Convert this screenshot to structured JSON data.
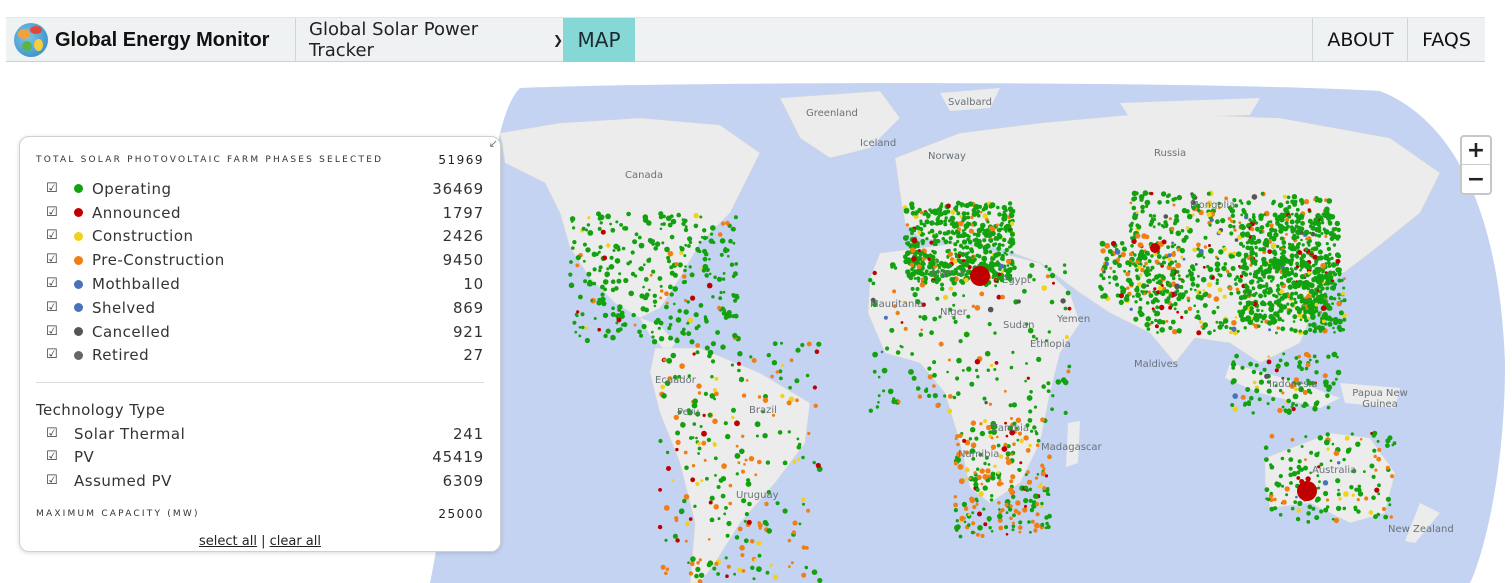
{
  "header": {
    "brand": "Global Energy Monitor",
    "tracker_label": "Global Solar Power Tracker",
    "map_tab": "MAP",
    "about": "ABOUT",
    "faqs": "FAQS"
  },
  "map": {
    "labels": [
      "Greenland",
      "Svalbard",
      "Iceland",
      "Norway",
      "Russia",
      "Canada",
      "Mongolia",
      "Algeria",
      "Egypt",
      "Mauritania",
      "Niger",
      "Sudan",
      "Yemen",
      "Ethiopia",
      "Maldives",
      "Indonesia",
      "Papua New Guinea",
      "Ecuador",
      "Peru",
      "Brazil",
      "Zambia",
      "Madagascar",
      "Namibia",
      "Uruguay",
      "Australia",
      "New Zealand"
    ],
    "colors": {
      "ocean": "#c3d3f1",
      "land": "#eeeeee",
      "operating": "#12a10f",
      "announced": "#c00000",
      "construction": "#f1d11c",
      "preconstruction": "#f07e14",
      "mothballed": "#4a72b8",
      "shelved": "#4a72b8",
      "cancelled": "#555555",
      "retired": "#666666"
    },
    "zoom_in": "+",
    "zoom_out": "−"
  },
  "legend": {
    "total_label": "TOTAL SOLAR PHOTOVOLTAIC FARM PHASES SELECTED",
    "total_value": "51969",
    "statuses": [
      {
        "label": "Operating",
        "count": "36469",
        "color": "#12a10f"
      },
      {
        "label": "Announced",
        "count": "1797",
        "color": "#c00000"
      },
      {
        "label": "Construction",
        "count": "2426",
        "color": "#f1d11c"
      },
      {
        "label": "Pre-Construction",
        "count": "9450",
        "color": "#f07e14"
      },
      {
        "label": "Mothballed",
        "count": "10",
        "color": "#4a72b8"
      },
      {
        "label": "Shelved",
        "count": "869",
        "color": "#4a72b8"
      },
      {
        "label": "Cancelled",
        "count": "921",
        "color": "#555555"
      },
      {
        "label": "Retired",
        "count": "27",
        "color": "#666666"
      }
    ],
    "tech_title": "Technology Type",
    "technologies": [
      {
        "label": "Solar Thermal",
        "count": "241"
      },
      {
        "label": "PV",
        "count": "45419"
      },
      {
        "label": "Assumed PV",
        "count": "6309"
      }
    ],
    "max_capacity_label": "MAXIMUM CAPACITY (MW)",
    "max_capacity_value": "25000",
    "select_all": "select all",
    "clear_all": "clear all",
    "separator": "|"
  }
}
